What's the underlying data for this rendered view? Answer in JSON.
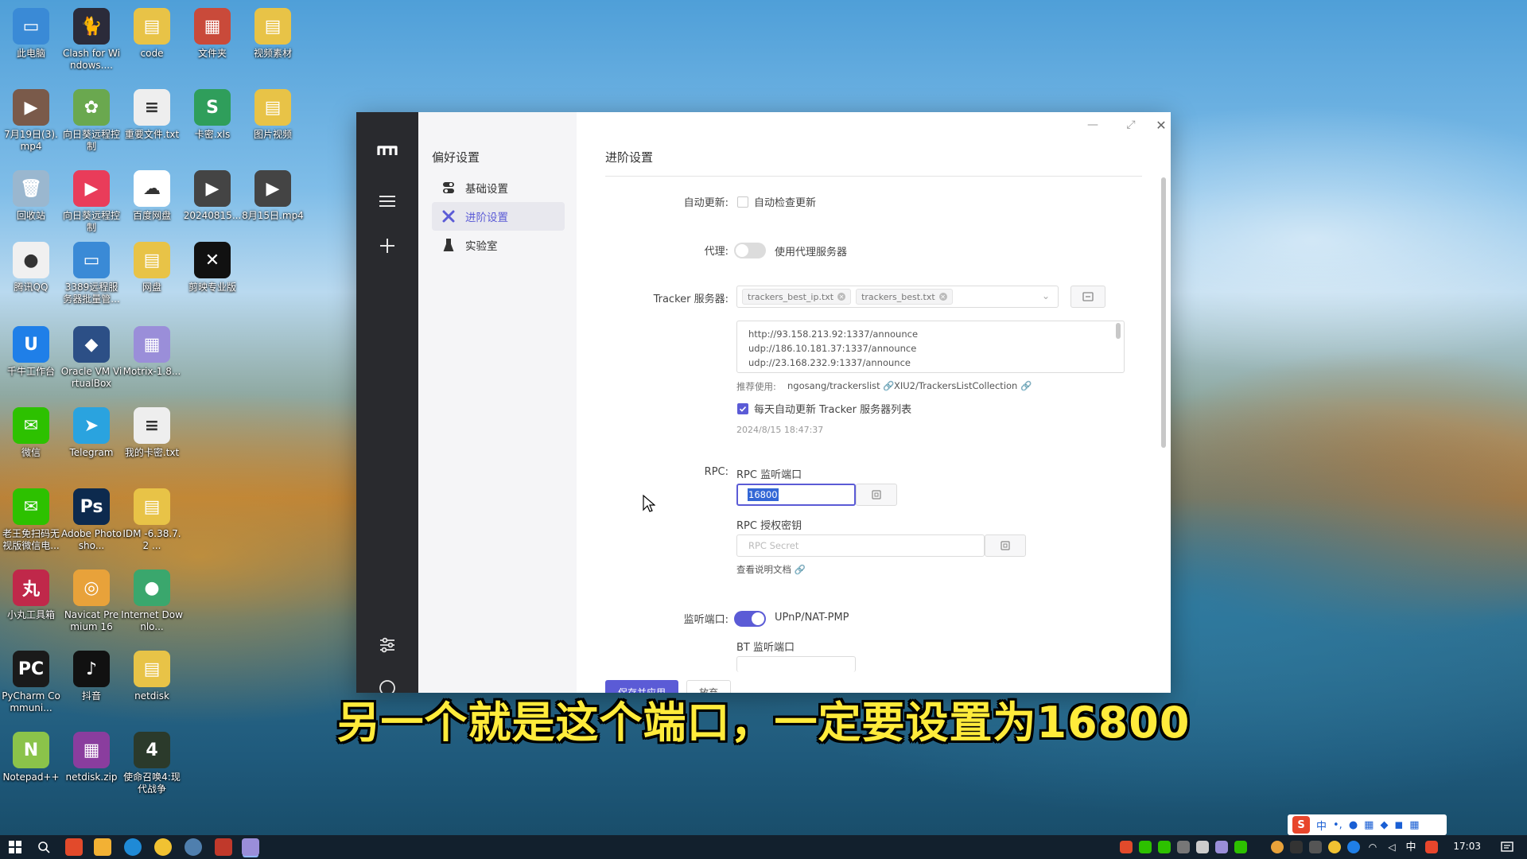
{
  "desktop_icons": [
    {
      "label": "此电脑",
      "color": "#3a8ad6",
      "glyph": "▭"
    },
    {
      "label": "Clash for Windows....",
      "color": "#2b2b3a",
      "glyph": "🐈"
    },
    {
      "label": "code",
      "color": "#e8c347",
      "glyph": "▤"
    },
    {
      "label": "文件夹",
      "color": "#c94a3a",
      "glyph": "▦"
    },
    {
      "label": "视频素材",
      "color": "#e8c347",
      "glyph": "▤"
    },
    {
      "label": "7月19日(3).mp4",
      "color": "#7a5a4a",
      "glyph": "▶"
    },
    {
      "label": "向日葵远程控制",
      "color": "#6aa84f",
      "glyph": "✿"
    },
    {
      "label": "重要文件.txt",
      "color": "#eeeeee",
      "glyph": "≡"
    },
    {
      "label": "卡密.xls",
      "color": "#2f9e5b",
      "glyph": "S"
    },
    {
      "label": "图片视频",
      "color": "#e8c347",
      "glyph": "▤"
    },
    {
      "label": "回收站",
      "color": "#9ab7cf",
      "glyph": "🗑"
    },
    {
      "label": "向日葵远程控制",
      "color": "#e93c5a",
      "glyph": "▶"
    },
    {
      "label": "百度网盘",
      "color": "#ffffff",
      "glyph": "☁"
    },
    {
      "label": "20240815...",
      "color": "#444444",
      "glyph": "▶"
    },
    {
      "label": "8月15日.mp4",
      "color": "#444444",
      "glyph": "▶"
    },
    {
      "label": "腾讯QQ",
      "color": "#f0f0f0",
      "glyph": "●"
    },
    {
      "label": "3389远程服务器批量管...",
      "color": "#3a8ad6",
      "glyph": "▭"
    },
    {
      "label": "网盘",
      "color": "#e8c347",
      "glyph": "▤"
    },
    {
      "label": "剪映专业版",
      "color": "#111111",
      "glyph": "✕"
    },
    {
      "label": "千牛工作台",
      "color": "#1f7fe8",
      "glyph": "U"
    },
    {
      "label": "Oracle VM VirtualBox",
      "color": "#2c4f86",
      "glyph": "◆"
    },
    {
      "label": "Motrix-1.8...",
      "color": "#9a8ed9",
      "glyph": "▦"
    },
    {
      "label": "微信",
      "color": "#2dc100",
      "glyph": "✉"
    },
    {
      "label": "Telegram",
      "color": "#2aa3df",
      "glyph": "➤"
    },
    {
      "label": "我的卡密.txt",
      "color": "#eeeeee",
      "glyph": "≡"
    },
    {
      "label": "老王免扫码无视版微信电...",
      "color": "#2dc100",
      "glyph": "✉"
    },
    {
      "label": "Adobe Photosho...",
      "color": "#0d2a4e",
      "glyph": "Ps"
    },
    {
      "label": "IDM -6.38.7.2 ...",
      "color": "#e8c347",
      "glyph": "▤"
    },
    {
      "label": "小丸工具箱",
      "color": "#c0284a",
      "glyph": "丸"
    },
    {
      "label": "Navicat Premium 16",
      "color": "#e8a23a",
      "glyph": "◎"
    },
    {
      "label": "Internet Downlo...",
      "color": "#3aa76d",
      "glyph": "●"
    },
    {
      "label": "PyCharm Communi...",
      "color": "#1a1a1a",
      "glyph": "PC"
    },
    {
      "label": "抖音",
      "color": "#111111",
      "glyph": "♪"
    },
    {
      "label": "netdisk",
      "color": "#e8c347",
      "glyph": "▤"
    },
    {
      "label": "Notepad++",
      "color": "#8bc34a",
      "glyph": "N"
    },
    {
      "label": "netdisk.zip",
      "color": "#8a3d9e",
      "glyph": "▦"
    },
    {
      "label": "使命召唤4:现代战争",
      "color": "#2b3a2b",
      "glyph": "4"
    }
  ],
  "app": {
    "sidebar_title": "偏好设置",
    "nav": [
      {
        "label": "基础设置",
        "icon": "toggle-icon",
        "active": false
      },
      {
        "label": "进阶设置",
        "icon": "tools-icon",
        "active": true
      },
      {
        "label": "实验室",
        "icon": "lab-icon",
        "active": false
      }
    ],
    "section_title": "进阶设置",
    "auto_update": {
      "label": "自动更新:",
      "checkbox_label": "自动检查更新"
    },
    "proxy": {
      "label": "代理:",
      "toggle_label": "使用代理服务器"
    },
    "tracker": {
      "label": "Tracker 服务器:",
      "tags": [
        "trackers_best_ip.txt",
        "trackers_best.txt"
      ],
      "lines": [
        "http://93.158.213.92:1337/announce",
        "udp://186.10.181.37:1337/announce",
        "udp://23.168.232.9:1337/announce"
      ],
      "recommend_label": "推荐使用:",
      "recommend_links": [
        "ngosang/trackerslist",
        "XIU2/TrackersListCollection"
      ],
      "auto_update_label": "每天自动更新 Tracker 服务器列表",
      "last_update": "2024/8/15 18:47:37"
    },
    "rpc": {
      "label": "RPC:",
      "port_label": "RPC 监听端口",
      "port_value": "16800",
      "secret_label": "RPC 授权密钥",
      "secret_placeholder": "RPC Secret",
      "doc_link": "查看说明文档"
    },
    "listen": {
      "label": "监听端口:",
      "toggle_label": "UPnP/NAT-PMP",
      "bt_label": "BT 监听端口"
    },
    "footer": {
      "save_label": "保存并应用",
      "discard_label": "放弃"
    }
  },
  "subtitle": "另一个就是这个端口，一定要设置为16800",
  "taskbar": {
    "time": "17:03",
    "lang": "中"
  },
  "ime": {
    "lang": "中"
  },
  "colors": {
    "accent": "#5b5bd6",
    "rail": "#292a2e",
    "subtitle": "#ffeb3b"
  }
}
